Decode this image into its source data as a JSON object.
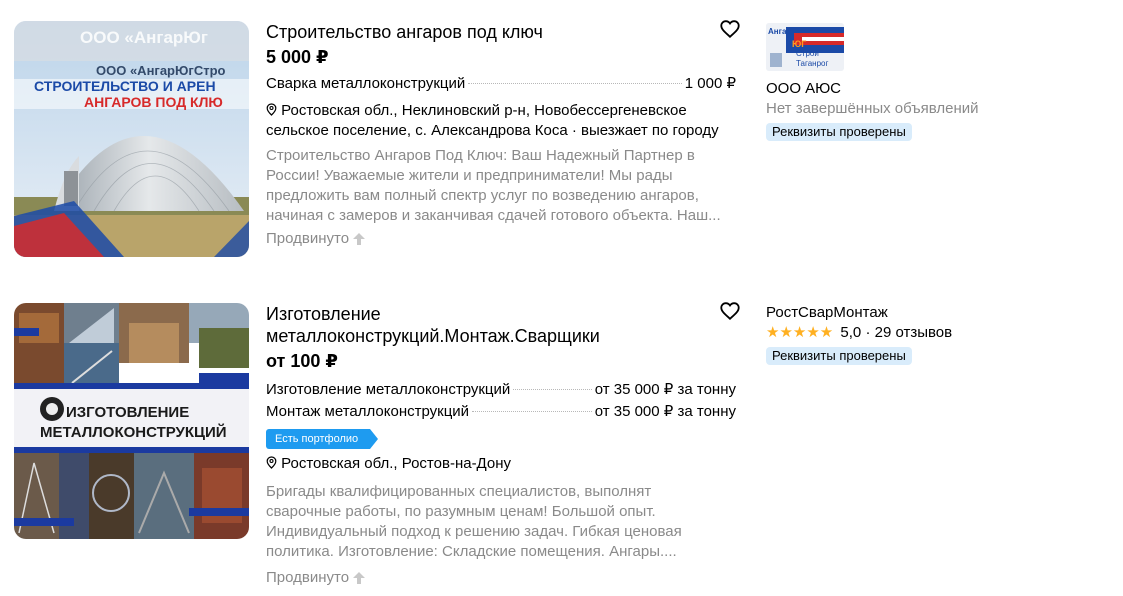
{
  "listings": [
    {
      "title": "Строительство ангаров под ключ",
      "price": "5 000 ₽",
      "services": [
        {
          "name": "Сварка металлоконструкций",
          "price": "1 000 ₽"
        }
      ],
      "location": "Ростовская обл., Неклиновский р-н, Новобессергеневское сельское поселение, с. Александрова Коса · выезжает по городу",
      "description": "Строительство Ангаров Под Ключ: Ваш Надежный Партнер в России! Уважаемые жители и предприниматели! Мы рады предложить вам полный спектр услуг по возведению ангаров, начиная с замеров и заканчивая сдачей готового объекта. Наш...",
      "promoted": "Продвинуто",
      "image": {
        "top_text_1": "ООО «АнгарЮг",
        "top_text_2": "ООО «АнгарЮгСтро",
        "banner_1": "СТРОИТЕЛЬСТВО И АРЕН",
        "banner_2": "АНГАРОВ ПОД КЛЮ"
      },
      "seller": {
        "logo_text_1": "Ангар",
        "logo_text_2": "ЮГ",
        "logo_text_3": "Строй",
        "logo_text_4": "Таганрог",
        "name": "ООО АЮС",
        "subtitle": "Нет завершённых объявлений",
        "badge": "Реквизиты проверены"
      }
    },
    {
      "title": "Изготовление металлоконструкций.Монтаж.Сварщики",
      "price": "от 100 ₽",
      "services": [
        {
          "name": "Изготовление металлоконструкций",
          "price": "от 35 000 ₽ за тонну"
        },
        {
          "name": "Монтаж металлоконструкций",
          "price": "от 35 000 ₽ за тонну"
        }
      ],
      "portfolio_badge": "Есть портфолио",
      "location": "Ростовская обл., Ростов-на-Дону",
      "description": "Бригады квалифицированных специалистов, выполнят сварочные работы, по разумным ценам! Большой опыт. Индивидуальный подход к решению задач. Гибкая ценовая политика. Изготовление: Складские помещения. Ангары....",
      "promoted": "Продвинуто",
      "image": {
        "banner_1": "ИЗГОТОВЛЕНИЕ",
        "banner_2": "МЕТАЛЛОКОНСТРУКЦИЙ"
      },
      "seller": {
        "name": "РостСварМонтаж",
        "stars": "★★★★★",
        "rating": "5,0 · 29 отзывов",
        "rating_value": 5.0,
        "badge": "Реквизиты проверены"
      }
    }
  ],
  "colors": {
    "accent": "#1e9bf0",
    "badge_bg": "#d9ecfb",
    "muted_text": "#8a8a8a",
    "star": "#ffb021"
  },
  "icons": [
    "heart-icon",
    "location-pin-icon",
    "promoted-arrow-icon",
    "star-icon"
  ]
}
